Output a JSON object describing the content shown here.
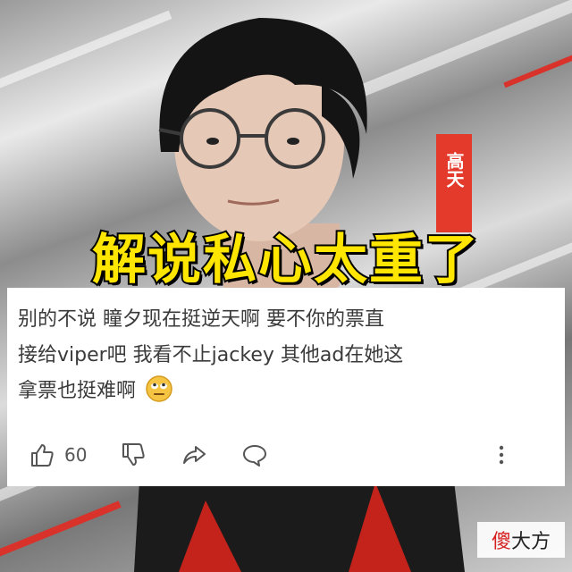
{
  "background": {
    "name_tag": "高天",
    "accent_color": "#e33a2c"
  },
  "headline": {
    "text": "解说私心太重了",
    "color": "#ffe600"
  },
  "comment": {
    "lines": [
      "别的不说 瞳夕现在挺逆天啊 要不你的票直",
      "接给viper吧 我看不止jackey 其他ad在她这",
      "拿票也挺难啊"
    ],
    "emoji": "eye-roll-emoji"
  },
  "actions": {
    "like_icon": "thumbs-up-icon",
    "like_count": "60",
    "dislike_icon": "thumbs-down-icon",
    "share_icon": "share-icon",
    "reply_icon": "comment-bubble-icon",
    "more_icon": "more-vertical-icon"
  },
  "watermark": {
    "first_char": "傻",
    "rest": "大方"
  }
}
